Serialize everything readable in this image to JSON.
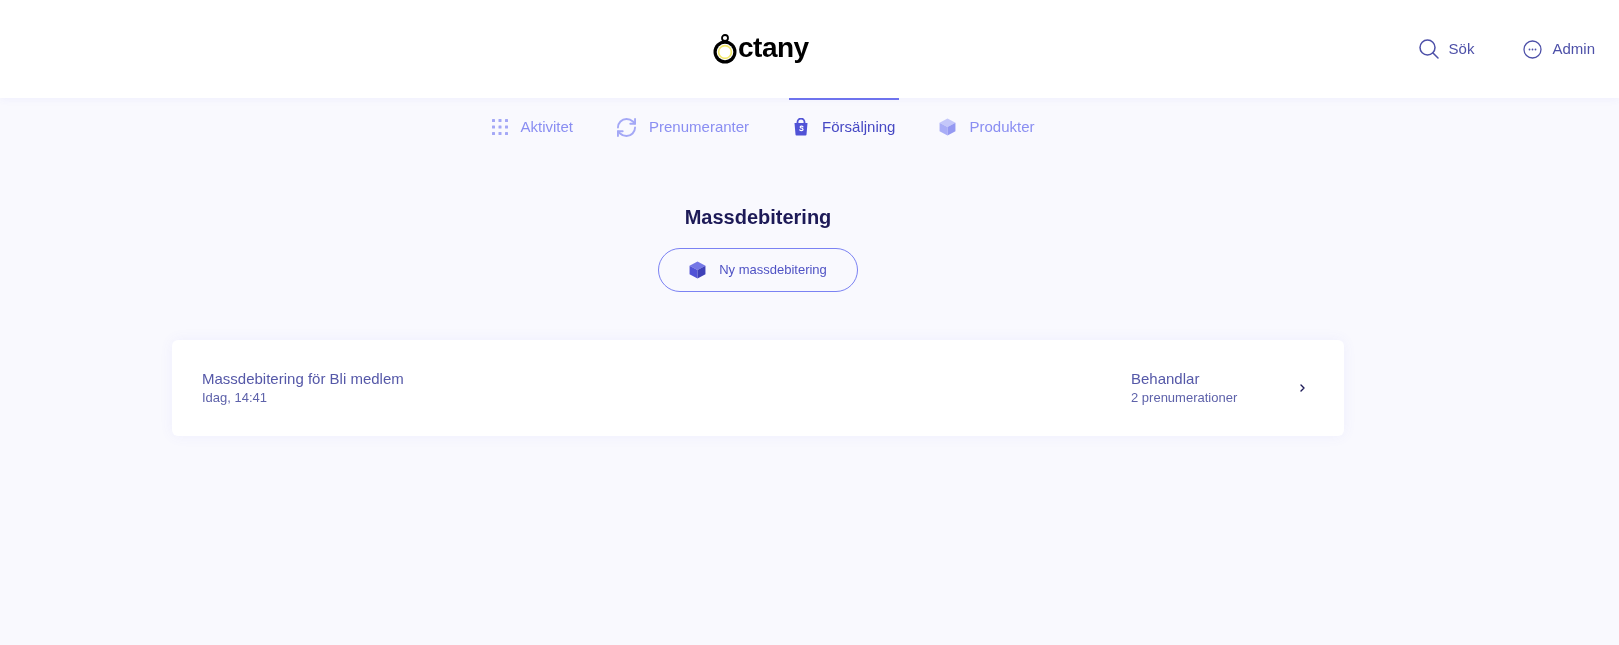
{
  "header": {
    "logo": {
      "text": "ctany"
    },
    "actions": [
      {
        "kind": "search",
        "label": "Sök"
      },
      {
        "kind": "account",
        "label": "Admin"
      }
    ]
  },
  "tabs": [
    {
      "kind": "activity",
      "label": "Aktivitet",
      "selected": false
    },
    {
      "kind": "subscriptions",
      "label": "Prenumeranter",
      "selected": false
    },
    {
      "kind": "sales",
      "label": "Försäljning",
      "selected": true
    },
    {
      "kind": "products",
      "label": "Produkter",
      "selected": false
    }
  ],
  "page": {
    "title": "Massdebitering",
    "new_button": {
      "label": "Ny massdebitering"
    }
  },
  "list": [
    {
      "title": "Massdebitering för Bli medlem",
      "date": "Idag, 14:41",
      "status": "Behandlar",
      "count": "2 prenumerationer"
    }
  ]
}
